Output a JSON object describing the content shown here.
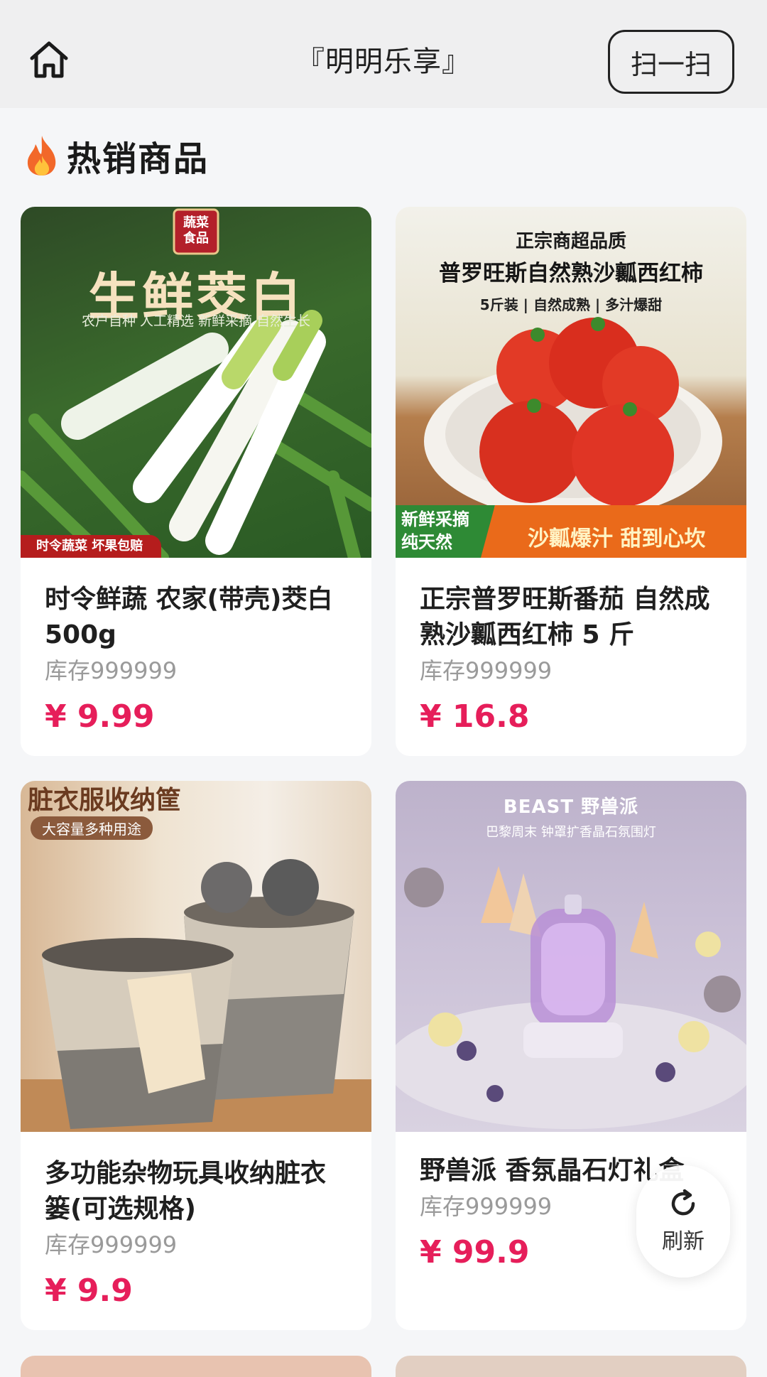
{
  "header": {
    "title": "『明明乐享』",
    "scan_label": "扫一扫",
    "home_icon": "home-icon"
  },
  "section": {
    "title": "热销商品",
    "icon": "fire-icon"
  },
  "products": [
    {
      "name": "时令鲜蔬 农家(带壳)茭白500g",
      "stock": "库存999999",
      "price": "¥ 9.99",
      "image": {
        "badge": "蔬菜食品",
        "headline": "生鲜茭白",
        "sub": "农户自种 人工精选 新鲜采摘 自然生长",
        "ribbon": "时令蔬菜 坏果包赔"
      }
    },
    {
      "name": "正宗普罗旺斯番茄 自然成熟沙瓤西红柿 5 斤",
      "stock": "库存999999",
      "price": "¥ 16.8",
      "image": {
        "top": "正宗商超品质",
        "headline": "普罗旺斯自然熟沙瓤西红柿",
        "sub": "5斤装 | 自然成熟 | 多汁爆甜",
        "left_banner": "新鲜采摘\n纯天然",
        "right_banner": "沙瓤爆汁 甜到心坎"
      }
    },
    {
      "name": "多功能杂物玩具收纳脏衣篓(可选规格)",
      "stock": "库存999999",
      "price": "¥ 9.9",
      "image": {
        "headline": "脏衣服收纳筐",
        "tag": "大容量多种用途"
      }
    },
    {
      "name": "野兽派 香氛晶石灯礼盒",
      "stock": "库存999999",
      "price": "¥ 99.9",
      "image": {
        "brand": "BEAST 野兽派",
        "sub": "巴黎周末 钟罩扩香晶石氛围灯"
      }
    }
  ],
  "refresh": {
    "label": "刷新",
    "icon": "refresh-icon"
  }
}
